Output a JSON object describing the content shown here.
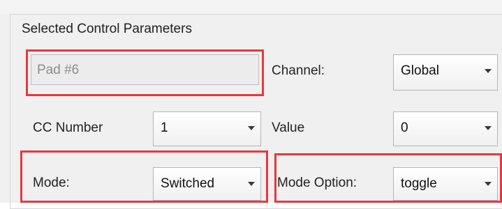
{
  "panel": {
    "title": "Selected Control Parameters",
    "pad_name_field": {
      "value": "Pad #6"
    },
    "channel": {
      "label": "Channel:",
      "value": "Global"
    },
    "cc_number": {
      "label": "CC Number",
      "value": "1"
    },
    "value_field": {
      "label": "Value",
      "value": "0"
    },
    "mode": {
      "label": "Mode:",
      "value": "Switched"
    },
    "mode_option": {
      "label": "Mode Option:",
      "value": "toggle"
    }
  },
  "icons": {
    "dropdown": "chevron-down-icon"
  },
  "colors": {
    "highlight": "#e8383d",
    "panel_bg": "#f0f0f0",
    "disabled_text": "#8c8c8c"
  }
}
